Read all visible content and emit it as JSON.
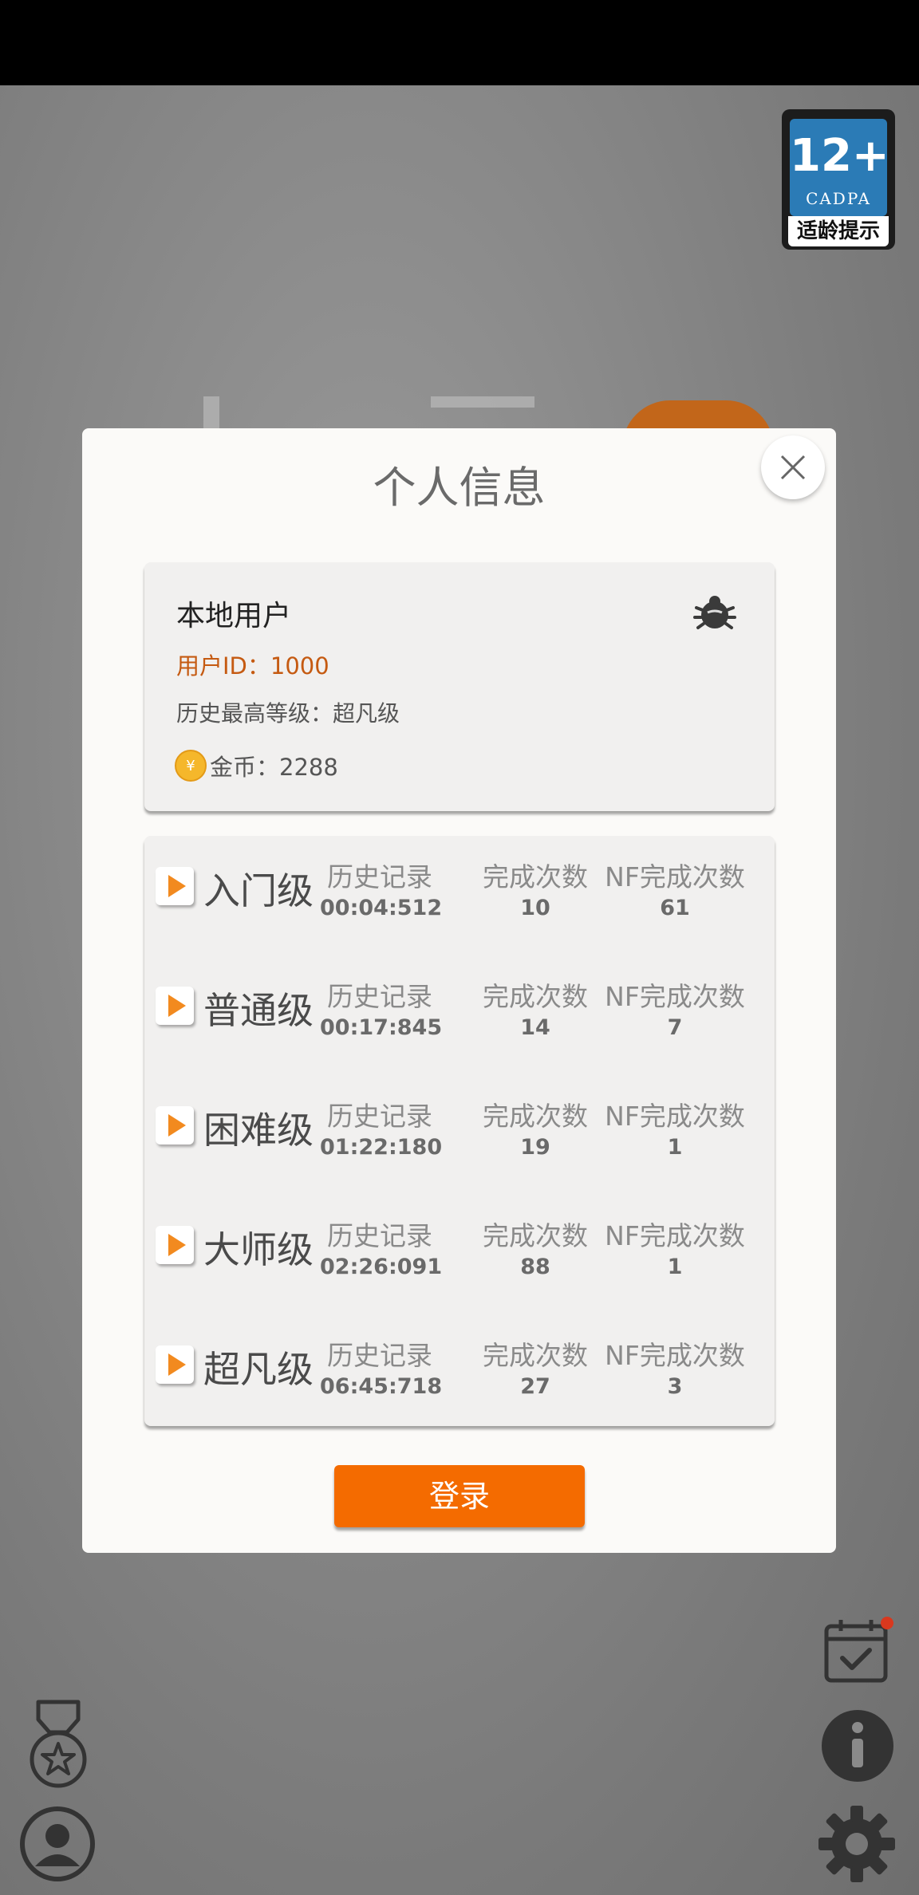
{
  "age_badge": {
    "number": "12+",
    "org": "CADPA",
    "caption": "适龄提示"
  },
  "modal": {
    "title": "个人信息",
    "user": {
      "name": "本地用户",
      "id_text": "用户ID：1000",
      "highest_level": "历史最高等级：超凡级",
      "coins": "金币：2288",
      "coin_symbol": "¥"
    },
    "levels": [
      {
        "name": "入门级",
        "record_label": "历史记录",
        "record": "00:04:512",
        "done_label": "完成次数",
        "done": "10",
        "nf_label": "NF完成次数",
        "nf": "61"
      },
      {
        "name": "普通级",
        "record_label": "历史记录",
        "record": "00:17:845",
        "done_label": "完成次数",
        "done": "14",
        "nf_label": "NF完成次数",
        "nf": "7"
      },
      {
        "name": "困难级",
        "record_label": "历史记录",
        "record": "01:22:180",
        "done_label": "完成次数",
        "done": "19",
        "nf_label": "NF完成次数",
        "nf": "1"
      },
      {
        "name": "大师级",
        "record_label": "历史记录",
        "record": "02:26:091",
        "done_label": "完成次数",
        "done": "88",
        "nf_label": "NF完成次数",
        "nf": "1"
      },
      {
        "name": "超凡级",
        "record_label": "历史记录",
        "record": "06:45:718",
        "done_label": "完成次数",
        "done": "27",
        "nf_label": "NF完成次数",
        "nf": "3"
      }
    ],
    "login_label": "登录"
  },
  "icons": {
    "close": "close-icon",
    "debug": "bug-icon",
    "calendar": "calendar-check-icon",
    "info": "info-icon",
    "settings": "gear-icon",
    "medal": "medal-icon",
    "user": "user-icon"
  },
  "colors": {
    "accent": "#f46b00",
    "user_id": "#c55a11",
    "badge_blue": "#2b7bb6",
    "notification_dot": "#d9381e"
  }
}
